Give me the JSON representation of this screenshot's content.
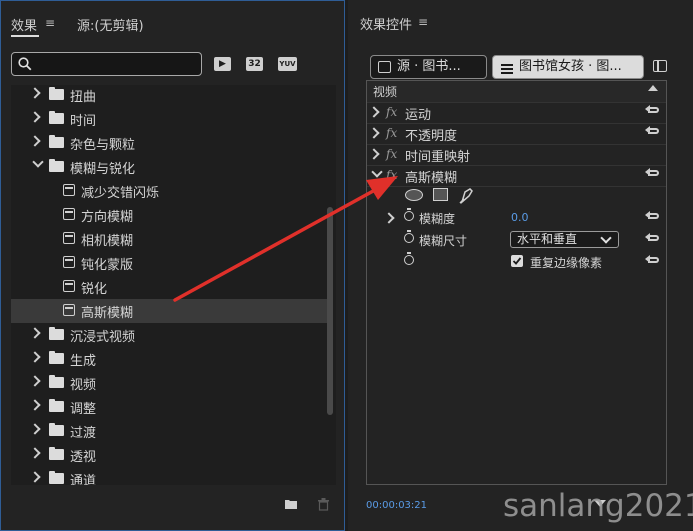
{
  "left_panel": {
    "tab_effects": "效果",
    "tab_source": "源:(无剪辑)",
    "search_placeholder": "",
    "toolbar_icons": [
      "32",
      "YUV"
    ],
    "tree": [
      {
        "label": "扭曲",
        "type": "folder",
        "expanded": false
      },
      {
        "label": "时间",
        "type": "folder",
        "expanded": false
      },
      {
        "label": "杂色与颗粒",
        "type": "folder",
        "expanded": false
      },
      {
        "label": "模糊与锐化",
        "type": "folder",
        "expanded": true
      },
      {
        "label": "减少交错闪烁",
        "type": "effect"
      },
      {
        "label": "方向模糊",
        "type": "effect"
      },
      {
        "label": "相机模糊",
        "type": "effect"
      },
      {
        "label": "钝化蒙版",
        "type": "effect"
      },
      {
        "label": "锐化",
        "type": "effect"
      },
      {
        "label": "高斯模糊",
        "type": "effect",
        "selected": true
      },
      {
        "label": "沉浸式视频",
        "type": "folder",
        "expanded": false
      },
      {
        "label": "生成",
        "type": "folder",
        "expanded": false
      },
      {
        "label": "视频",
        "type": "folder",
        "expanded": false
      },
      {
        "label": "调整",
        "type": "folder",
        "expanded": false
      },
      {
        "label": "过渡",
        "type": "folder",
        "expanded": false
      },
      {
        "label": "透视",
        "type": "folder",
        "expanded": false
      },
      {
        "label": "通道",
        "type": "folder",
        "expanded": false
      }
    ]
  },
  "right_panel": {
    "title": "效果控件",
    "tab_source": "源 · 图书...",
    "tab_sequence": "图书馆女孩 · 图...",
    "section_label": "视频",
    "effects": [
      {
        "label": "运动",
        "fx": "fx"
      },
      {
        "label": "不透明度",
        "fx": "fx"
      },
      {
        "label": "时间重映射",
        "fx": "fx"
      },
      {
        "label": "高斯模糊",
        "fx": "fx",
        "expanded": true
      }
    ],
    "params": {
      "blurriness_label": "模糊度",
      "blurriness_value": "0.0",
      "blur_dimensions_label": "模糊尺寸",
      "blur_dimensions_value": "水平和垂直",
      "repeat_edge_label": "重复边缘像素",
      "repeat_edge_checked": true
    },
    "timecode": "00:00:03:21"
  },
  "watermark": "sanlang2021",
  "colors": {
    "accent_blue": "#2f5d96",
    "timecode": "#5a9be6",
    "arrow_red": "#e0302a"
  }
}
